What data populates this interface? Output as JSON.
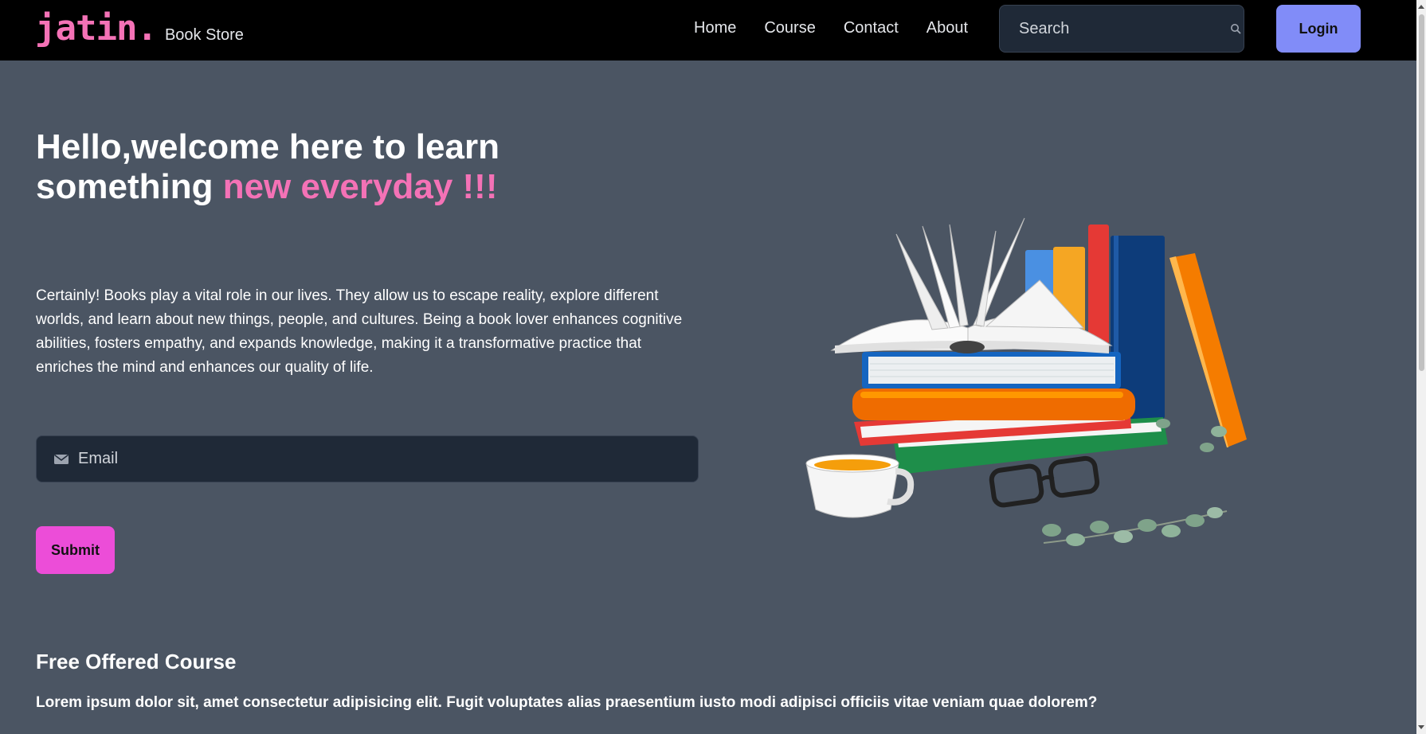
{
  "navbar": {
    "logo": "jatin.",
    "subtitle": "Book Store",
    "links": [
      "Home",
      "Course",
      "Contact",
      "About"
    ],
    "search_placeholder": "Search",
    "login_label": "Login"
  },
  "hero": {
    "title_part1": "Hello,welcome here to learn something ",
    "title_accent": "new everyday !!!",
    "description": "Certainly! Books play a vital role in our lives. They allow us to escape reality, explore different worlds, and learn about new things, people, and cultures. Being a book lover enhances cognitive abilities, fosters empathy, and expands knowledge, making it a transformative practice that enriches the mind and enhances our quality of life.",
    "email_placeholder": "Email",
    "submit_label": "Submit"
  },
  "courses": {
    "heading": "Free Offered Course",
    "text": "Lorem ipsum dolor sit, amet consectetur adipisicing elit. Fugit voluptates alias praesentium iusto modi adipisci officiis vitae veniam quae dolorem?"
  },
  "colors": {
    "background": "#4b5563",
    "navbar": "#000000",
    "accent_pink": "#f472b6",
    "login_button": "#818cf8",
    "submit_button": "#ec4dd8"
  },
  "icons": {
    "search": "search-icon",
    "email": "mail-icon"
  }
}
